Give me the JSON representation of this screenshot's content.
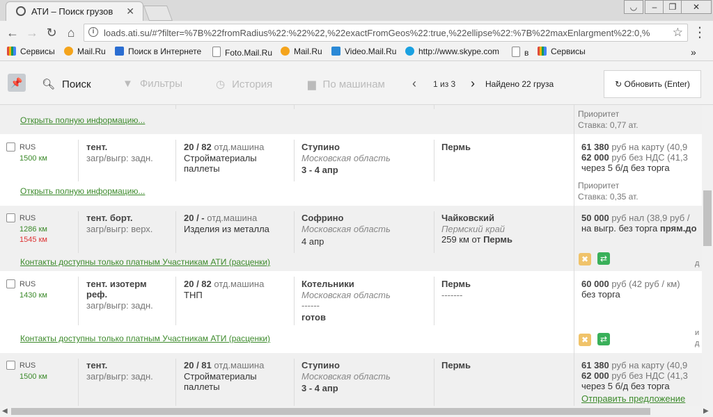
{
  "browser": {
    "tab_title": "АТИ – Поиск грузов",
    "url": "loads.ati.su/#?filter=%7B%22fromRadius%22:%22%22,%22exactFromGeos%22:true,%22ellipse%22:%7B%22maxEnlargment%22:0,%",
    "window_controls": [
      "user-icon",
      "minimize-icon",
      "restore-icon",
      "close-icon"
    ]
  },
  "bookmarks": [
    {
      "label": "Сервисы",
      "icon": "apps-icon",
      "color": "#e04b3c"
    },
    {
      "label": "Mail.Ru",
      "icon": "mailru-icon",
      "color": "#f4a41c"
    },
    {
      "label": "Поиск в Интернете",
      "icon": "search-icon",
      "color": "#2a6dd1"
    },
    {
      "label": "Foto.Mail.Ru",
      "icon": "page-icon",
      "color": "#ffffff"
    },
    {
      "label": "Mail.Ru",
      "icon": "mailru-icon",
      "color": "#f4a41c"
    },
    {
      "label": "Video.Mail.Ru",
      "icon": "video-icon",
      "color": "#2a89d6"
    },
    {
      "label": "http://www.skype.com",
      "icon": "skype-icon",
      "color": "#1aa1e1"
    },
    {
      "label": "в",
      "icon": "page-icon",
      "color": "#ffffff"
    },
    {
      "label": "Сервисы",
      "icon": "apps-icon",
      "color": "#e04b3c"
    }
  ],
  "header": {
    "search": "Поиск",
    "filters": "Фильтры",
    "history": "История",
    "by_trucks": "По машинам",
    "pages": "1 из 3",
    "found": "Найдено 22 груза",
    "refresh": "Обновить (Enter)"
  },
  "rows": [
    {
      "partial": true,
      "link": "Открыть полную информацию...",
      "priority": "Приоритет",
      "rate": "Ставка: 0,77 ат."
    },
    {
      "country": "RUS",
      "km": "1500 км",
      "truck": "тент.",
      "load_type": "загр/выгр: задн.",
      "weight": "20 / 82",
      "weight_note": "отд.машина",
      "cargo1": "Стройматериалы",
      "cargo2": "паллеты",
      "from": "Ступино",
      "from_region": "Московская область",
      "date": "3 - 4 апр",
      "to": "Пермь",
      "price1": "61 380",
      "price1_note": "руб на карту (40,9",
      "price2": "62 000",
      "price2_note": "руб без НДС (41,3",
      "terms": "через 5 б/д без торга",
      "link": "Открыть полную информацию...",
      "priority": "Приоритет",
      "rate": "Ставка: 0,35 ат."
    },
    {
      "country": "RUS",
      "km": "1286 км",
      "km2": "1545 км",
      "truck": "тент. борт.",
      "load_type": "загр/выгр: верх.",
      "weight": "20 / -",
      "weight_note": "отд.машина",
      "cargo1": "Изделия из металла",
      "from": "Софрино",
      "from_region": "Московская область",
      "date": "4 апр",
      "to": "Чайковский",
      "to_region": "Пермский край",
      "to_distance": "259 км от",
      "to_distance_city": "Пермь",
      "price1": "50 000",
      "price1_note": "руб нал (38,9 руб /",
      "terms_prefix": "на выгр. без торга",
      "terms_bold": "прям.до",
      "contacts_link": "Контакты доступны только платным Участникам АТИ (расценки)",
      "edge_text": "д"
    },
    {
      "country": "RUS",
      "km": "1430 км",
      "truck": "тент. изотерм",
      "truck2": "реф.",
      "load_type": "загр/выгр: задн.",
      "weight": "20 / 82",
      "weight_note": "отд.машина",
      "cargo1": "ТНП",
      "from": "Котельники",
      "from_region": "Московская область",
      "from_dash": "------",
      "status": "готов",
      "to": "Пермь",
      "to_dash": "-------",
      "price1": "60 000",
      "price1_note": "руб (42 руб / км)",
      "terms": "без торга",
      "contacts_link": "Контакты доступны только платным Участникам АТИ (расценки)",
      "edge_text1": "и",
      "edge_text2": "д"
    },
    {
      "country": "RUS",
      "km": "1500 км",
      "truck": "тент.",
      "load_type": "загр/выгр: задн.",
      "weight": "20 / 81",
      "weight_note": "отд.машина",
      "cargo1": "Стройматериалы",
      "cargo2": "паллеты",
      "from": "Ступино",
      "from_region": "Московская область",
      "date": "3 - 4 апр",
      "to": "Пермь",
      "price1": "61 380",
      "price1_note": "руб на карту (40,9",
      "price2": "62 000",
      "price2_note": "руб без НДС (41,3",
      "terms": "через 5 б/д без торга",
      "offer_link": "Отправить предложение"
    }
  ],
  "colors": {
    "green_link": "#3c8a2b",
    "badge_yellow": "#f0c36a",
    "badge_green": "#3ab05a",
    "km_red": "#dd3333"
  }
}
